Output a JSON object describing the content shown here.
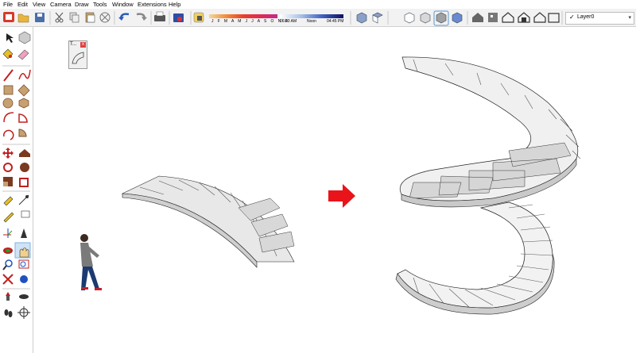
{
  "menu": [
    "File",
    "Edit",
    "View",
    "Camera",
    "Draw",
    "Tools",
    "Window",
    "Extensions",
    "Help"
  ],
  "shadow_settings": {
    "months": "J F M A M J J A S O N D",
    "time_start": "06:43 AM",
    "time_noon": "Noon",
    "time_end": "04:45 PM"
  },
  "layer": {
    "current": "Layer0",
    "check": "✓",
    "dropdown": "▾"
  },
  "floating_window": {
    "title": "T...",
    "close": "x"
  },
  "icons": {
    "top_toolbar": [
      "select-icon",
      "open-icon",
      "save-icon",
      "cut-icon",
      "copy-icon",
      "erase-icon",
      "undo-icon",
      "redo-icon",
      "print-icon",
      "model-info-icon",
      "shadow-toggle-icon",
      "iso-view-icon",
      "top-view-icon",
      "front-view-icon",
      "right-view-icon",
      "back-view-icon",
      "left-view-icon",
      "3d-warehouse-icon",
      "components-icon",
      "house-icon",
      "house-share-icon",
      "house-outline-icon"
    ],
    "left_toolbar": [
      "select-tool",
      "component-tool",
      "paint-bucket-tool",
      "eraser-tool",
      "line-tool",
      "freehand-tool",
      "rectangle-tool",
      "rotated-rectangle-tool",
      "circle-tool",
      "polygon-tool",
      "arc-tool",
      "pie-tool",
      "move-tool",
      "push-pull-tool",
      "rotate-tool",
      "follow-me-tool",
      "scale-tool",
      "offset-tool",
      "tape-measure-tool",
      "dimension-tool",
      "protractor-tool",
      "text-tool",
      "axes-tool",
      "3d-text-tool",
      "orbit-tool",
      "pan-tool",
      "zoom-tool",
      "zoom-window-tool",
      "zoom-extents-tool",
      "previous-view-tool",
      "position-camera-tool",
      "look-around-tool",
      "walk-tool",
      "section-plane-tool"
    ]
  },
  "colors": {
    "arrow": "#e8141a",
    "active_tool": "#cfe3f7",
    "stair_top": "#ffffff",
    "stair_face": "#d4d4d4",
    "stair_dark": "#aaaaaa"
  }
}
